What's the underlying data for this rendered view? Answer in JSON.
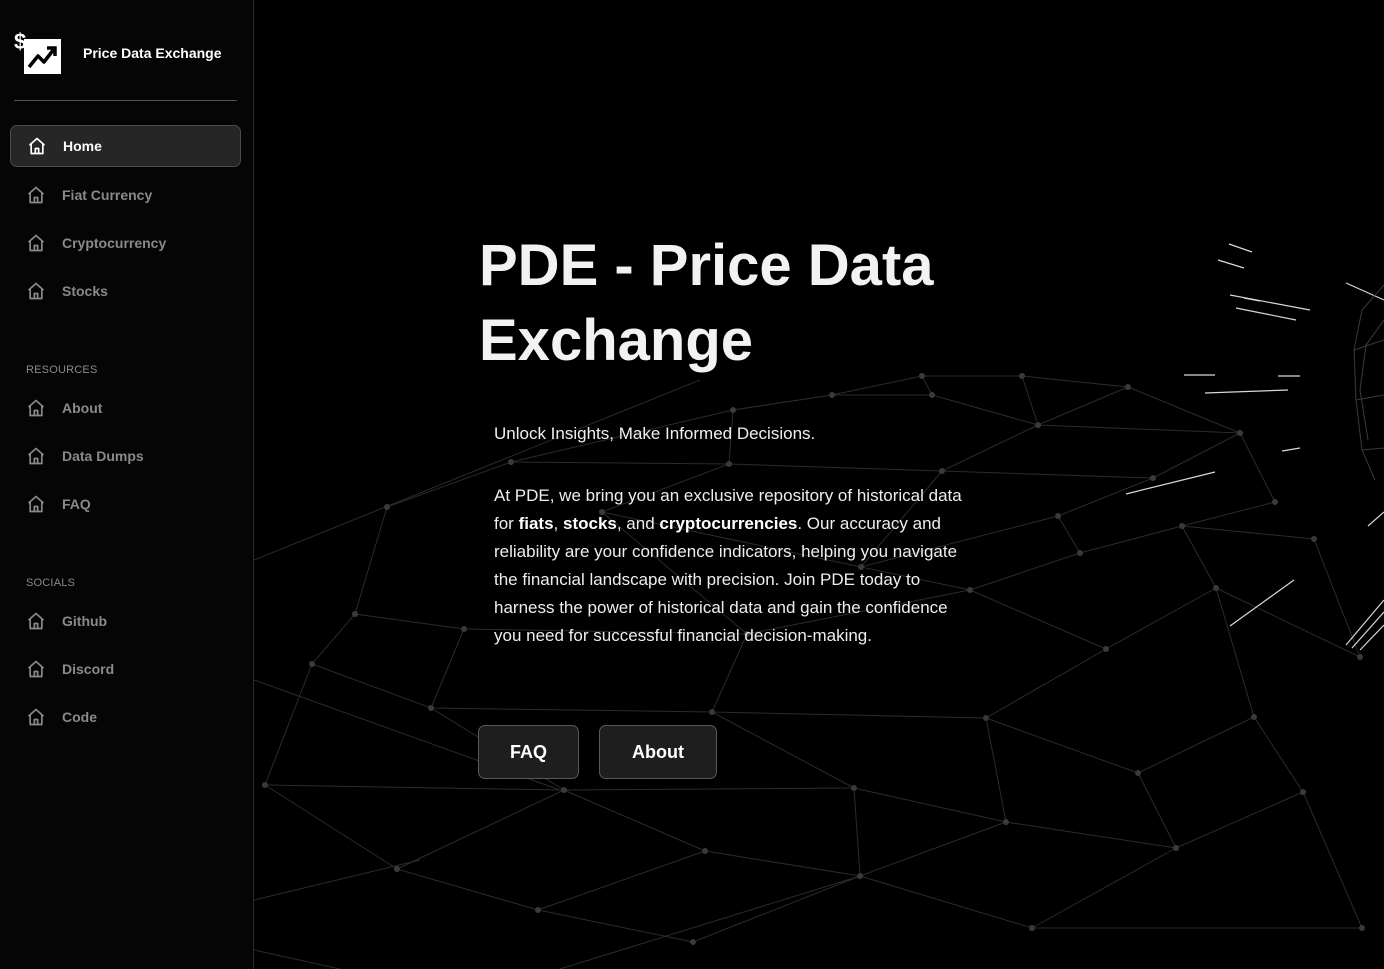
{
  "brand": {
    "name": "Price Data Exchange",
    "logo_icon": "dollar-trend-up-icon"
  },
  "nav": {
    "main": [
      {
        "label": "Home",
        "icon": "home-icon",
        "active": true
      },
      {
        "label": "Fiat Currency",
        "icon": "home-icon",
        "active": false
      },
      {
        "label": "Cryptocurrency",
        "icon": "home-icon",
        "active": false
      },
      {
        "label": "Stocks",
        "icon": "home-icon",
        "active": false
      }
    ],
    "resources_label": "RESOURCES",
    "resources": [
      {
        "label": "About",
        "icon": "home-icon"
      },
      {
        "label": "Data Dumps",
        "icon": "home-icon"
      },
      {
        "label": "FAQ",
        "icon": "home-icon"
      }
    ],
    "socials_label": "SOCIALS",
    "socials": [
      {
        "label": "Github",
        "icon": "home-icon"
      },
      {
        "label": "Discord",
        "icon": "home-icon"
      },
      {
        "label": "Code",
        "icon": "home-icon"
      }
    ]
  },
  "hero": {
    "title": "PDE - Price Data Exchange",
    "tagline": "Unlock Insights, Make Informed Decisions.",
    "description_parts": {
      "p1": "At PDE, we bring you an exclusive repository of historical data for ",
      "b1": "fiats",
      "s1": ", ",
      "b2": "stocks",
      "s2": ", and ",
      "b3": "cryptocurrencies",
      "p2": ". Our accuracy and reliability are your confidence indicators, helping you navigate the financial landscape with precision. Join PDE today to harness the power of historical data and gain the confidence you need for successful financial decision-making."
    },
    "buttons": {
      "faq": "FAQ",
      "about": "About"
    }
  },
  "colors": {
    "background": "#000000",
    "sidebar": "#050505",
    "active_item": "#262626",
    "muted_text": "#8a8a8a",
    "button_bg": "#1e1e1e"
  }
}
